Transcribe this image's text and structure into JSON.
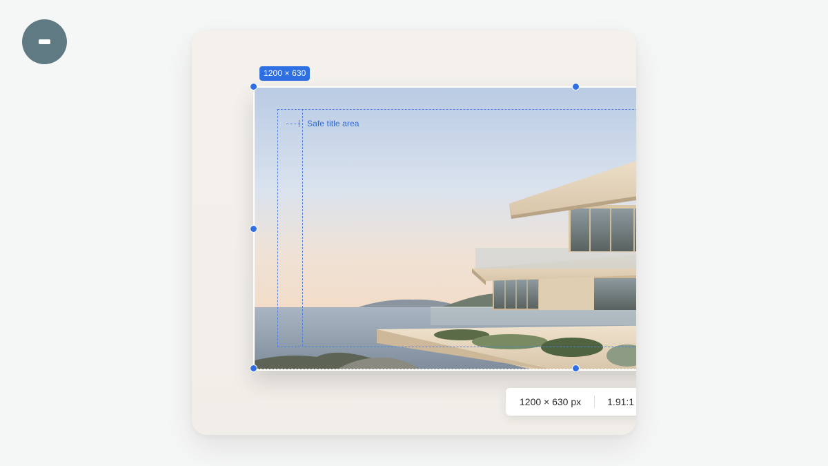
{
  "toolbar": {
    "collapse_icon": "minus-icon"
  },
  "canvas": {
    "size_badge": "1200 × 630",
    "safe_area_label": "Safe title area"
  },
  "info": {
    "dimensions": "1200 × 630 px",
    "ratio": "1.91:1"
  },
  "colors": {
    "accent": "#2f6fe4",
    "collapse_button": "#5f7a82",
    "card": "#f3efea",
    "page_background": "#f5f6f6"
  }
}
